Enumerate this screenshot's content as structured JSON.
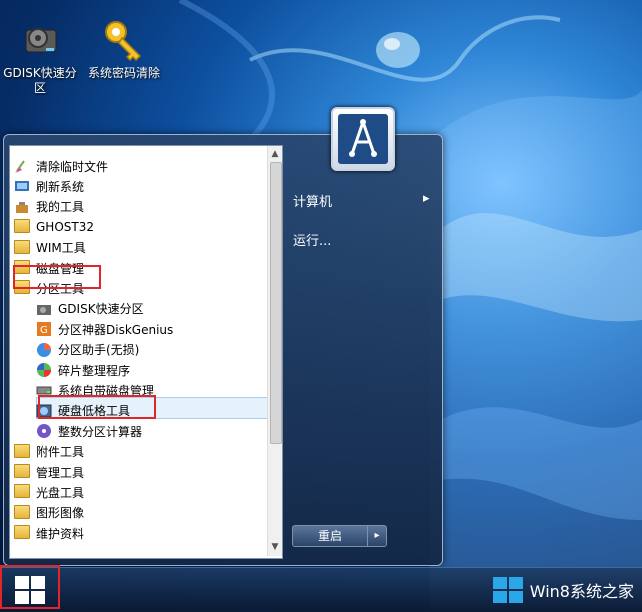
{
  "desktop": {
    "icons": [
      {
        "label": "GDISK快速分区",
        "icon": "disk-gear-icon"
      },
      {
        "label": "系统密码清除",
        "icon": "key-icon"
      }
    ]
  },
  "start_menu": {
    "programs": [
      {
        "label": "清除临时文件",
        "icon": "broom-icon",
        "level": 0
      },
      {
        "label": "刷新系统",
        "icon": "refresh-icon",
        "level": 0
      },
      {
        "label": "我的工具",
        "icon": "toolbox-icon",
        "level": 0
      },
      {
        "label": "GHOST32",
        "icon": "folder-icon",
        "level": 0
      },
      {
        "label": "WIM工具",
        "icon": "folder-icon",
        "level": 0
      },
      {
        "label": "磁盘管理",
        "icon": "folder-icon",
        "level": 0
      },
      {
        "label": "分区工具",
        "icon": "folder-icon",
        "level": 0
      },
      {
        "label": "GDISK快速分区",
        "icon": "disk-gear-icon",
        "level": 1
      },
      {
        "label": "分区神器DiskGenius",
        "icon": "diskgenius-icon",
        "level": 1
      },
      {
        "label": "分区助手(无损)",
        "icon": "pie-icon",
        "level": 1
      },
      {
        "label": "碎片整理程序",
        "icon": "defrag-icon",
        "level": 1
      },
      {
        "label": "系统自带磁盘管理",
        "icon": "drive-icon",
        "level": 1
      },
      {
        "label": "硬盘低格工具",
        "icon": "hdd-format-icon",
        "level": 1
      },
      {
        "label": "整数分区计算器",
        "icon": "calc-disk-icon",
        "level": 1
      },
      {
        "label": "附件工具",
        "icon": "folder-icon",
        "level": 0
      },
      {
        "label": "管理工具",
        "icon": "folder-icon",
        "level": 0
      },
      {
        "label": "光盘工具",
        "icon": "folder-icon",
        "level": 0
      },
      {
        "label": "图形图像",
        "icon": "folder-icon",
        "level": 0
      },
      {
        "label": "维护资料",
        "icon": "folder-icon",
        "level": 0
      }
    ],
    "right_items": [
      {
        "label": "计算机",
        "has_arrow": true,
        "arrow": "▸"
      },
      {
        "label": "运行...",
        "has_arrow": false
      }
    ],
    "shutdown_label": "重启",
    "shutdown_arrow": "▸"
  },
  "taskbar": {
    "brand": "Win8系统之家"
  },
  "colors": {
    "highlight_box": "#e0262b",
    "selection": "#e5f1fb"
  }
}
